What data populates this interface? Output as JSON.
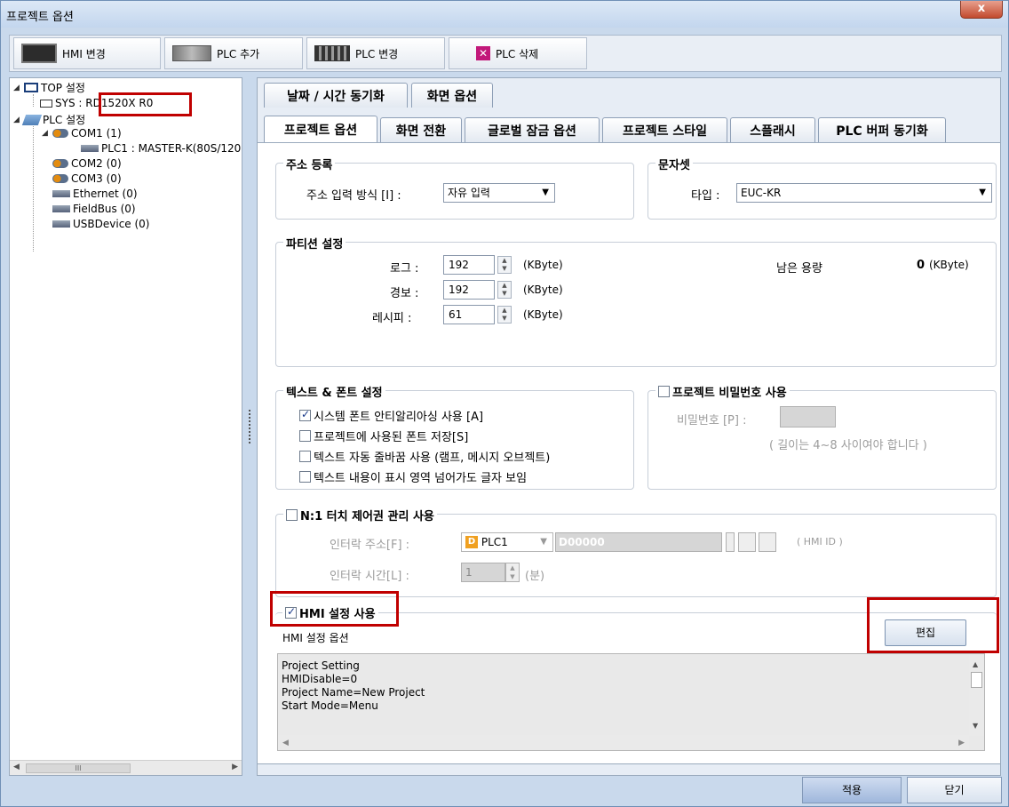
{
  "window": {
    "title": "프로젝트 옵션",
    "close_glyph": "x"
  },
  "toolbar": {
    "hmi_change": "HMI 변경",
    "plc_add": "PLC 추가",
    "plc_change": "PLC 변경",
    "plc_delete": "PLC 삭제",
    "plc_delete_glyph": "✕"
  },
  "tree": {
    "top_setting": "TOP 설정",
    "sys": "SYS : RD1520X R0",
    "plc_setting": "PLC 설정",
    "com1": "COM1 (1)",
    "plc1": "PLC1 : MASTER-K(80S/120",
    "com2": "COM2 (0)",
    "com3": "COM3 (0)",
    "ethernet": "Ethernet (0)",
    "fieldbus": "FieldBus (0)",
    "usbdevice": "USBDevice (0)",
    "scroll_thumb": "III"
  },
  "tabs_row1": [
    "날짜 / 시간 동기화",
    "화면 옵션"
  ],
  "tabs_row2": [
    "프로젝트 옵션",
    "화면 전환",
    "글로벌 잠금 옵션",
    "프로젝트 스타일",
    "스플래시",
    "PLC 버퍼 동기화"
  ],
  "address": {
    "title": "주소 등록",
    "input_label": "주소 입력 방식 [I] :",
    "input_value": "자유 입력"
  },
  "charset": {
    "title": "문자셋",
    "type_label": "타입 :",
    "type_value": "EUC-KR"
  },
  "partition": {
    "title": "파티션 설정",
    "log_label": "로그 :",
    "log_value": "192",
    "alarm_label": "경보 :",
    "alarm_value": "192",
    "recipe_label": "레시피 :",
    "recipe_value": "61",
    "unit": "(KByte)",
    "remain_label": "남은 용량",
    "remain_value": "0",
    "remain_unit": "(KByte)"
  },
  "text_font": {
    "title": "텍스트 & 폰트 설정",
    "opt1": "시스템 폰트 안티알리아싱 사용 [A]",
    "opt2": "프로젝트에 사용된 폰트 저장[S]",
    "opt3": "텍스트 자동 줄바꿈 사용 (램프, 메시지 오브젝트)",
    "opt4": "텍스트 내용이 표시 영역 넘어가도 글자 보임"
  },
  "password": {
    "title": "프로젝트 비밀번호 사용",
    "pw_label": "비밀번호 [P] :",
    "hint": "( 길이는 4~8 사이여야 합니다 )"
  },
  "n1touch": {
    "title": "N:1 터치 제어권 관리 사용",
    "interlock_addr_label": "인터락 주소[F] :",
    "plc_value": "PLC1",
    "plc_badge": "D",
    "addr_value": "D00000",
    "hmi_id": "( HMI ID )",
    "interlock_time_label": "인터락 시간[L] :",
    "time_value": "1",
    "time_unit": "(분)"
  },
  "hmi": {
    "title": "HMI 설정 사용",
    "options_label": "HMI 설정 옵션",
    "edit_button": "편집",
    "lines": [
      "Project Setting",
      "HMIDisable=0",
      "Project Name=New Project",
      "Start Mode=Menu"
    ]
  },
  "footer": {
    "apply": "적용",
    "close": "닫기"
  },
  "colors": {
    "highlight": "#c00000",
    "window": "#c9d9ec"
  }
}
